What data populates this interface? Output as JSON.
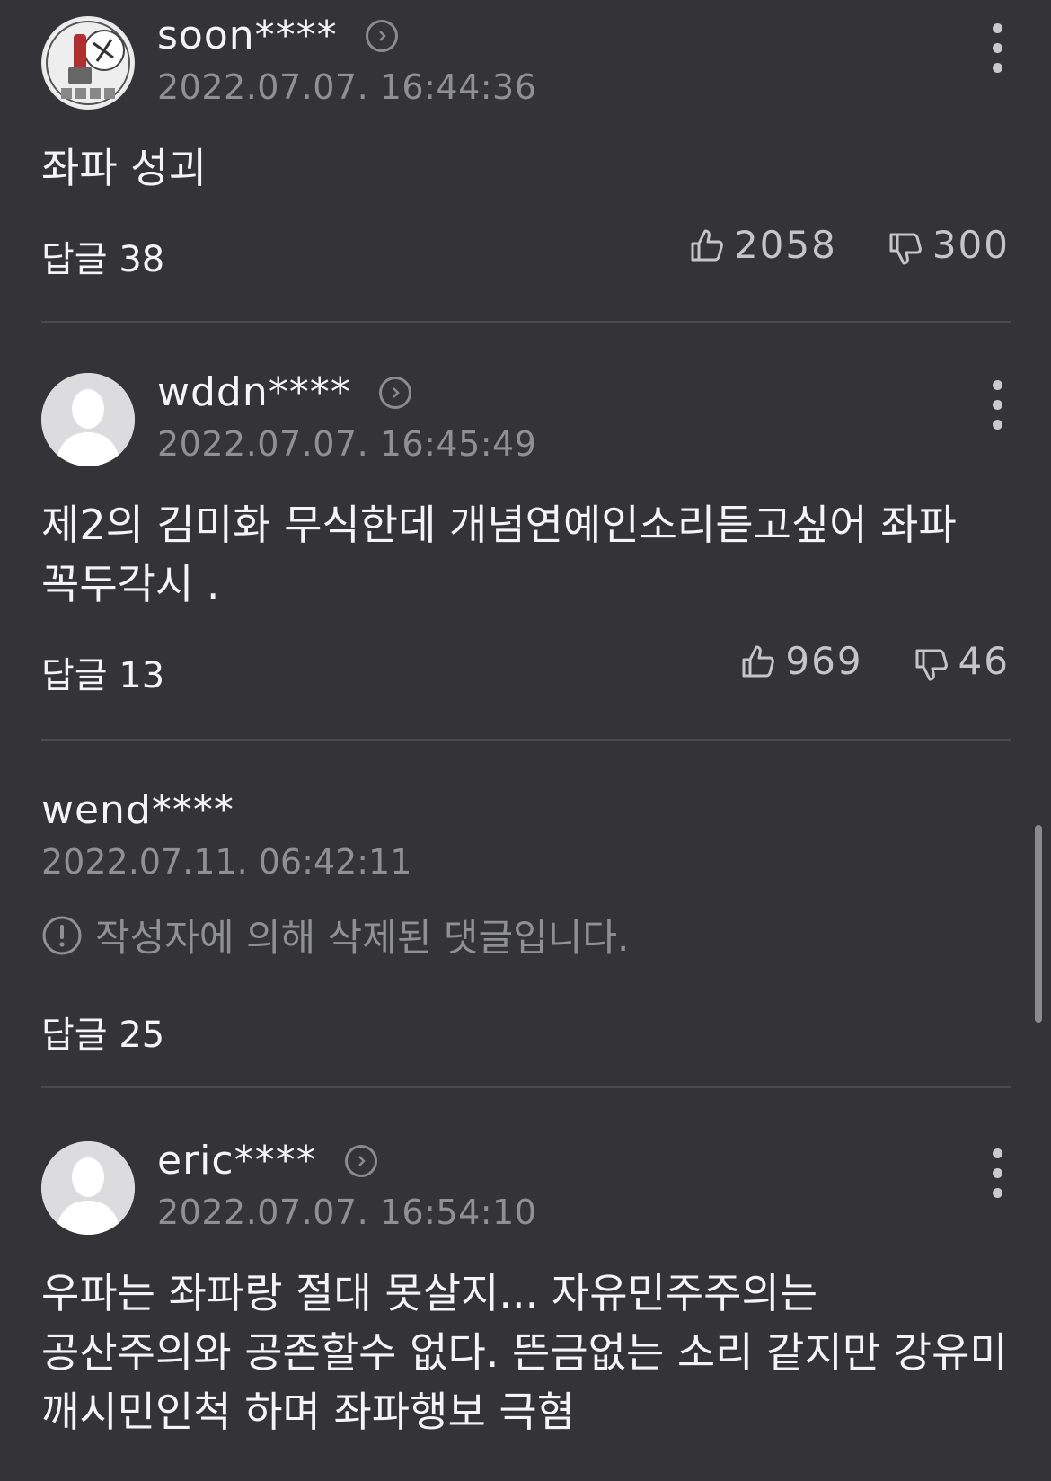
{
  "comments": [
    {
      "username": "soon****",
      "timestamp": "2022.07.07. 16:44:36",
      "text": "좌파 성괴",
      "reply_label": "답글 38",
      "likes": "2058",
      "dislikes": "300",
      "avatar": "custom-illustration"
    },
    {
      "username": "wddn****",
      "timestamp": "2022.07.07. 16:45:49",
      "text": "제2의 김미화 무식한데 개념연예인소리듣고싶어 좌파 꼭두각시 .",
      "reply_label": "답글 13",
      "likes": "969",
      "dislikes": "46",
      "avatar": "default-person"
    },
    {
      "username": "wend****",
      "timestamp": "2022.07.11. 06:42:11",
      "deleted_notice": "작성자에 의해 삭제된 댓글입니다.",
      "reply_label": "답글 25"
    },
    {
      "username": "eric****",
      "timestamp": "2022.07.07. 16:54:10",
      "text": "우파는 좌파랑 절대 못살지... 자유민주주의는 공산주의와 공존할수 없다. 뜬금없는 소리 같지만 강유미 깨시민인척 하며 좌파행보 극혐",
      "avatar": "default-person"
    }
  ],
  "icons": {
    "like": "thumbs-up-icon",
    "dislike": "thumbs-down-icon",
    "more": "more-vertical-icon",
    "profile": "chevron-right-circle-icon",
    "deleted": "exclamation-circle-icon"
  },
  "colors": {
    "background": "#333338",
    "text": "#f4f4f6",
    "muted": "#8f8f96"
  }
}
